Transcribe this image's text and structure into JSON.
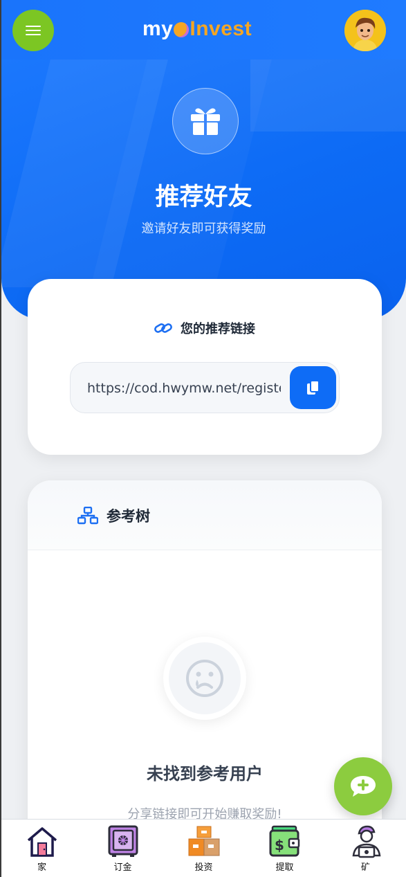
{
  "header": {
    "logo_text_left": "my",
    "logo_text_right": "Invest",
    "menu_icon": "hamburger-icon",
    "avatar": "user-avatar"
  },
  "hero": {
    "icon": "gift-icon",
    "title": "推荐好友",
    "subtitle": "邀请好友即可获得奖励"
  },
  "referral_link": {
    "icon": "link-icon",
    "heading": "您的推荐链接",
    "value": "https://cod.hwymw.net/register",
    "copy_icon": "copy-icon"
  },
  "reference_tree": {
    "icon": "sitemap-icon",
    "heading": "参考树",
    "empty_icon": "sad-face-icon",
    "empty_title": "未找到参考用户",
    "empty_subtitle": "分享链接即可开始赚取奖励!"
  },
  "fab": {
    "icon": "chat-plus-icon"
  },
  "bottom_nav": {
    "items": [
      {
        "label": "家",
        "icon": "home-icon"
      },
      {
        "label": "订金",
        "icon": "safe-icon"
      },
      {
        "label": "投资",
        "icon": "boxes-icon"
      },
      {
        "label": "提取",
        "icon": "wallet-icon"
      },
      {
        "label": "矿",
        "icon": "miner-icon"
      }
    ]
  },
  "colors": {
    "primary": "#0e6cf6",
    "accent_green": "#8ccc3f",
    "logo_orange": "#f5a623"
  }
}
